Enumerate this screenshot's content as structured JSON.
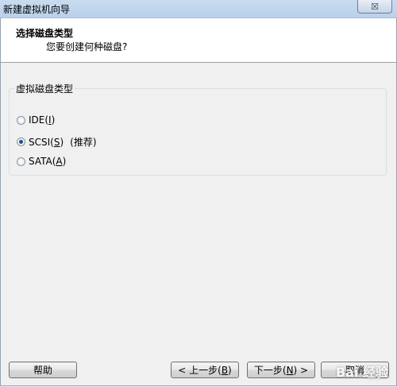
{
  "window": {
    "title": "新建虚拟机向导",
    "close_glyph": "☒"
  },
  "header": {
    "title": "选择磁盘类型",
    "subtitle": "您要创建何种磁盘?"
  },
  "disk_group": {
    "legend": "虚拟磁盘类型",
    "options": [
      {
        "prefix": "IDE(",
        "hotkey": "I",
        "suffix": ")",
        "note": "",
        "selected": false
      },
      {
        "prefix": "SCSI(",
        "hotkey": "S",
        "suffix": ")",
        "note": "(推荐)",
        "selected": true
      },
      {
        "prefix": "SATA(",
        "hotkey": "A",
        "suffix": ")",
        "note": "",
        "selected": false
      }
    ]
  },
  "buttons": {
    "help": "帮助",
    "back": {
      "prefix": "< 上一步(",
      "hotkey": "B",
      "suffix": ")"
    },
    "next": {
      "prefix": "下一步(",
      "hotkey": "N",
      "suffix": ") >"
    },
    "cancel": "取消"
  },
  "watermark": "Bai 经验"
}
